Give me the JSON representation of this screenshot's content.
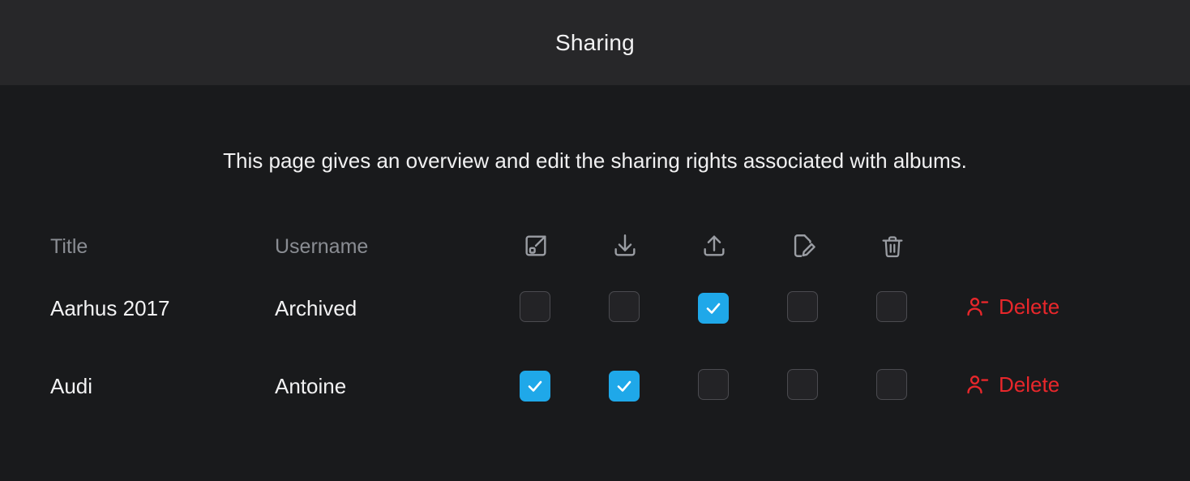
{
  "window": {
    "title": "Sharing"
  },
  "page": {
    "description": "This page gives an overview and edit the sharing rights associated with albums."
  },
  "colors": {
    "header_bg": "#272729",
    "body_bg": "#191a1c",
    "accent_checked": "#1fa8e9",
    "danger": "#e8272b",
    "muted_text": "#8a8d93",
    "primary_text": "#f2f2f3",
    "checkbox_bg": "#232326",
    "checkbox_border": "#4b4b50"
  },
  "table": {
    "columns": [
      {
        "key": "title",
        "label": "Title",
        "type": "text"
      },
      {
        "key": "username",
        "label": "Username",
        "type": "text"
      },
      {
        "key": "share",
        "label": "",
        "type": "icon",
        "icon": "share-external-icon"
      },
      {
        "key": "download",
        "label": "",
        "type": "icon",
        "icon": "download-icon"
      },
      {
        "key": "upload",
        "label": "",
        "type": "icon",
        "icon": "upload-icon"
      },
      {
        "key": "edit",
        "label": "",
        "type": "icon",
        "icon": "file-edit-icon"
      },
      {
        "key": "delete",
        "label": "",
        "type": "icon",
        "icon": "trash-icon"
      }
    ],
    "rows": [
      {
        "title": "Aarhus 2017",
        "username": "Archived",
        "permissions": {
          "share": false,
          "download": false,
          "upload": true,
          "edit": false,
          "delete": false
        },
        "action": {
          "icon": "user-minus-icon",
          "label": "Delete"
        }
      },
      {
        "title": "Audi",
        "username": "Antoine",
        "permissions": {
          "share": true,
          "download": true,
          "upload": false,
          "edit": false,
          "delete": false
        },
        "action": {
          "icon": "user-minus-icon",
          "label": "Delete"
        }
      }
    ]
  }
}
